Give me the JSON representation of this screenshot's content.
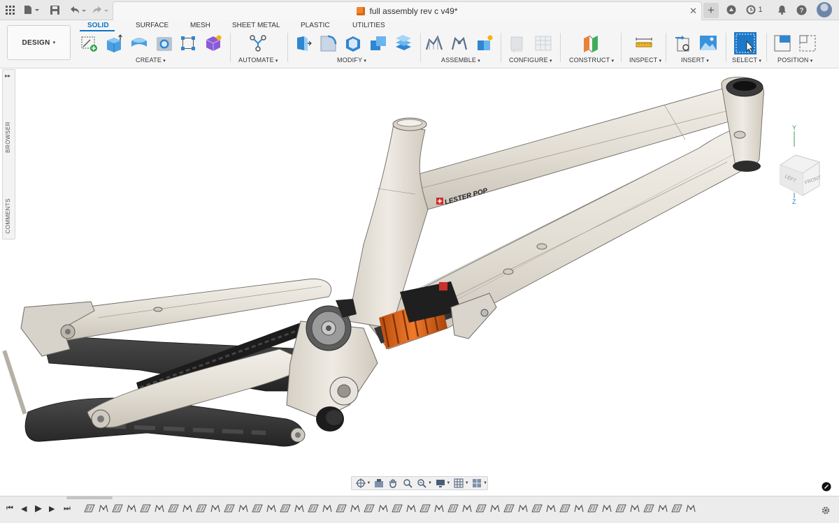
{
  "window": {
    "document_title": "full assembly rev c v49*",
    "job_count": "1"
  },
  "icons": {
    "app_grid": "app-grid-icon",
    "file": "file-icon",
    "save": "save-icon",
    "undo": "undo-icon",
    "redo": "redo-icon",
    "close": "close-icon",
    "new_tab": "plus-icon",
    "extensions": "extensions-icon",
    "jobs": "clock-icon",
    "notifications": "bell-icon",
    "help": "help-icon",
    "account": "avatar-icon"
  },
  "workspace": {
    "mode_button": "DESIGN",
    "tabs": [
      "SOLID",
      "SURFACE",
      "MESH",
      "SHEET METAL",
      "PLASTIC",
      "UTILITIES"
    ],
    "active_tab": "SOLID"
  },
  "ribbon_groups": [
    "CREATE",
    "AUTOMATE",
    "MODIFY",
    "ASSEMBLE",
    "CONFIGURE",
    "CONSTRUCT",
    "INSPECT",
    "INSERT",
    "SELECT",
    "POSITION"
  ],
  "browser_rail": {
    "expand": "▸▸",
    "browser": "BROWSER",
    "comments": "COMMENTS"
  },
  "model": {
    "decal_text": "LESTER POP"
  },
  "viewcube": {
    "axis_y": "Y",
    "axis_z": "Z",
    "face_left": "LEFT",
    "face_front": "FRONT"
  },
  "navbar": [
    "orbit-icon",
    "look-at-icon",
    "pan-icon",
    "zoom-window-icon",
    "zoom-icon",
    "display-settings-icon",
    "grid-settings-icon",
    "viewports-icon"
  ],
  "timeline": {
    "feature_count": 44,
    "controls": [
      "skip-to-start-icon",
      "step-back-icon",
      "play-icon",
      "step-forward-icon",
      "skip-to-end-icon"
    ]
  },
  "colors": {
    "accent": "#0a74c4",
    "frame": "#e6e2da",
    "shock_spring": "#e0661a",
    "carbon": "#3a3a3a"
  }
}
